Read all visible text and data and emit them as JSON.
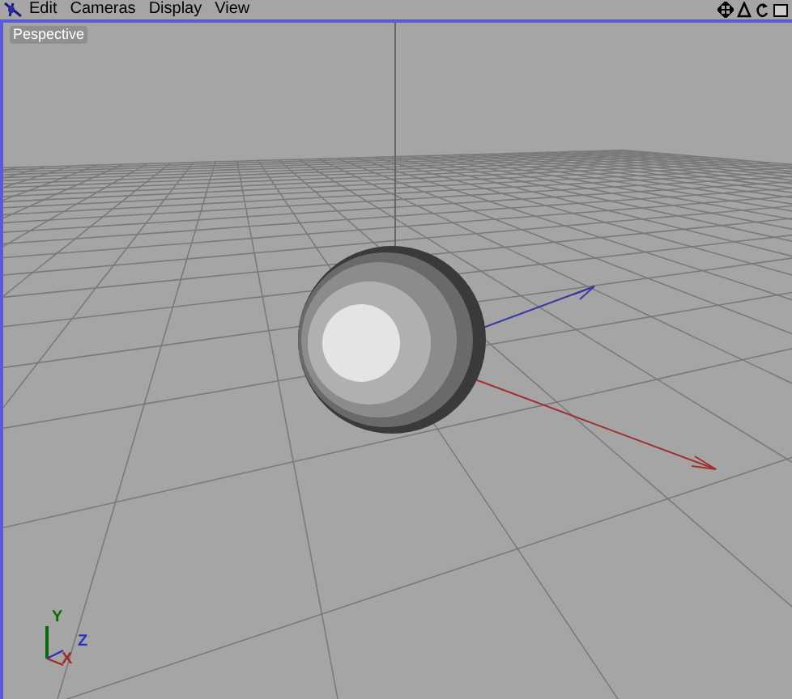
{
  "menu": [
    {
      "label": "Edit"
    },
    {
      "label": "Cameras"
    },
    {
      "label": "Display"
    },
    {
      "label": "View"
    }
  ],
  "viewport": {
    "title": "Pespective",
    "axis_labels": [
      {
        "kind": "y",
        "label": "Y"
      },
      {
        "kind": "z",
        "label": "Z"
      },
      {
        "kind": "x",
        "label": "X"
      }
    ]
  }
}
